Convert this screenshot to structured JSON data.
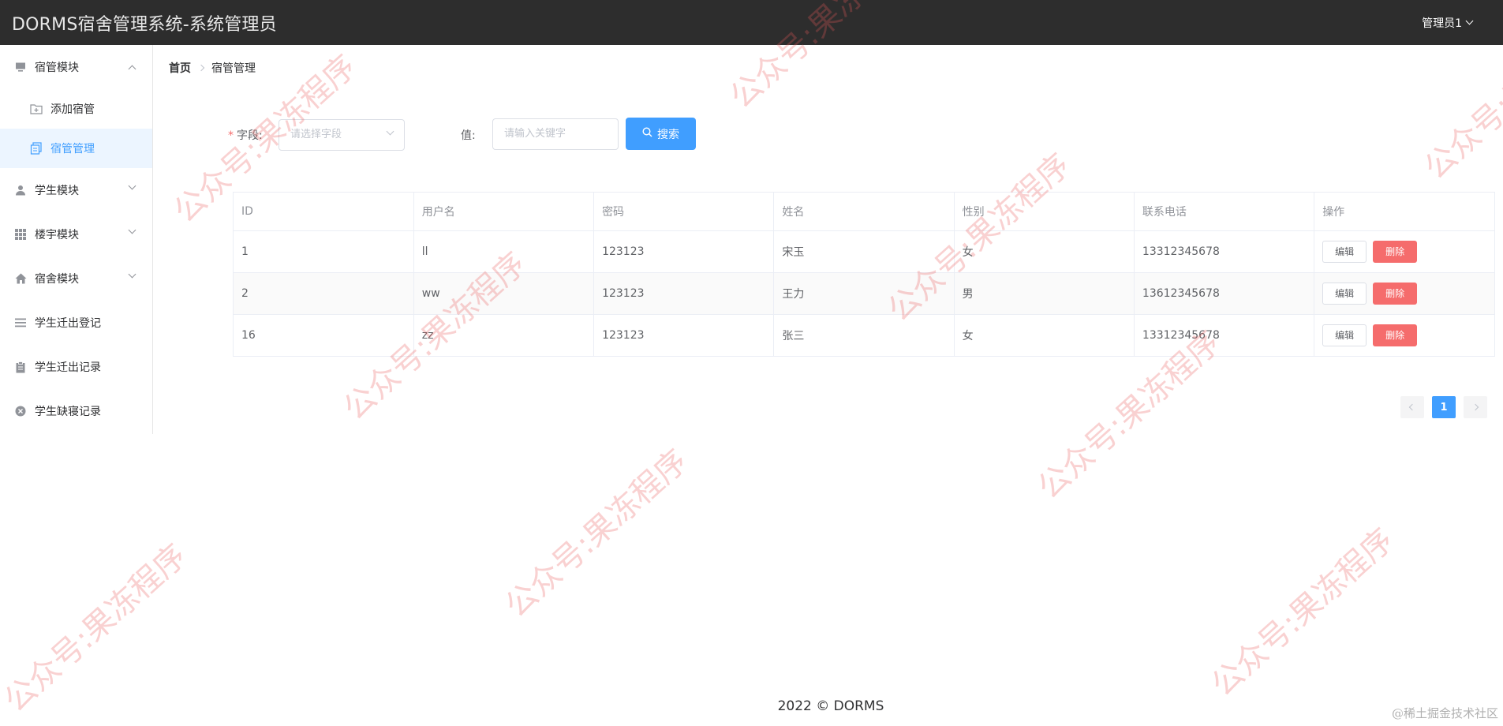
{
  "header": {
    "title": "DORMS宿舍管理系统-系统管理员",
    "user": "管理员1"
  },
  "sidebar": {
    "items": [
      {
        "label": "宿管模块",
        "icon": "monitor-icon",
        "expanded": true,
        "children": [
          {
            "label": "添加宿管",
            "icon": "folder-add-icon"
          },
          {
            "label": "宿管管理",
            "icon": "document-copy-icon",
            "active": true
          }
        ]
      },
      {
        "label": "学生模块",
        "icon": "user-icon"
      },
      {
        "label": "楼宇模块",
        "icon": "grid-icon"
      },
      {
        "label": "宿舍模块",
        "icon": "house-icon"
      },
      {
        "label": "学生迁出登记",
        "icon": "list-icon"
      },
      {
        "label": "学生迁出记录",
        "icon": "clipboard-icon"
      },
      {
        "label": "学生缺寝记录",
        "icon": "circle-close-icon"
      }
    ]
  },
  "breadcrumb": {
    "home": "首页",
    "current": "宿管管理"
  },
  "search": {
    "field_label": "字段:",
    "field_placeholder": "请选择字段",
    "value_label": "值:",
    "value_placeholder": "请输入关键字",
    "button_label": "搜索"
  },
  "table": {
    "columns": [
      "ID",
      "用户名",
      "密码",
      "姓名",
      "性别",
      "联系电话",
      "操作"
    ],
    "rows": [
      {
        "id": "1",
        "username": "ll",
        "password": "123123",
        "name": "宋玉",
        "gender": "女",
        "phone": "13312345678"
      },
      {
        "id": "2",
        "username": "ww",
        "password": "123123",
        "name": "王力",
        "gender": "男",
        "phone": "13612345678"
      },
      {
        "id": "16",
        "username": "zz",
        "password": "123123",
        "name": "张三",
        "gender": "女",
        "phone": "13312345678"
      }
    ],
    "edit_label": "编辑",
    "delete_label": "删除"
  },
  "pagination": {
    "current_page": "1"
  },
  "footer": {
    "text": "2022 © DORMS",
    "credit": "@稀土掘金技术社区"
  },
  "watermark": {
    "text": "公众号:果冻程序"
  },
  "colors": {
    "primary": "#409eff",
    "danger": "#f56c6c",
    "header_bg": "#2d2d2d"
  }
}
